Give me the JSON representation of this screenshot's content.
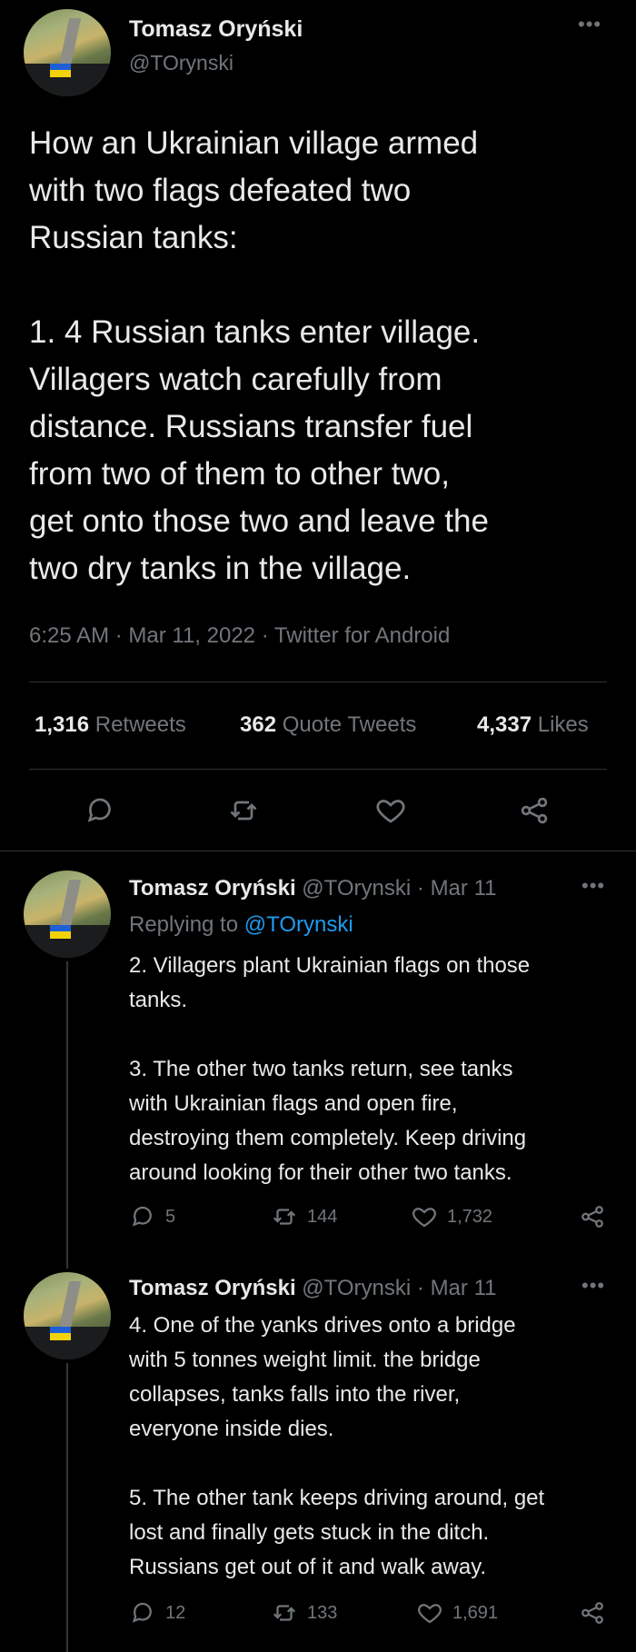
{
  "main_tweet": {
    "author_name": "Tomasz Oryński",
    "author_handle": "@TOrynski",
    "text_lines": [
      "How an Ukrainian village armed",
      "with two flags defeated two",
      "Russian tanks:",
      "",
      "1. 4 Russian tanks enter village.",
      "Villagers watch carefully from",
      "distance. Russians transfer fuel",
      "from two of them to other two,",
      "get onto those two and leave the",
      "two dry tanks in the village."
    ],
    "meta": "6:25 AM · Mar 11, 2022 · Twitter for Android",
    "stats": {
      "retweets_count": "1,316",
      "retweets_label": "Retweets",
      "quotes_count": "362",
      "quotes_label": "Quote Tweets",
      "likes_count": "4,337",
      "likes_label": "Likes"
    },
    "more_icon": "more-icon"
  },
  "replies": [
    {
      "author_name": "Tomasz Oryński",
      "author_handle": "@TOrynski",
      "date": "· Mar 11",
      "replying_prefix": "Replying to",
      "replying_handle": "@TOrynski",
      "text_lines": [
        "2. Villagers plant Ukrainian flags on those",
        "tanks.",
        "",
        "3. The other two tanks return, see tanks",
        "with Ukrainian flags and open fire,",
        "destroying them completely. Keep driving",
        "around looking for their other two tanks."
      ],
      "reply_count": "5",
      "retweet_count": "144",
      "like_count": "1,732"
    },
    {
      "author_name": "Tomasz Oryński",
      "author_handle": "@TOrynski",
      "date": "· Mar 11",
      "text_lines": [
        "4. One of the yanks drives onto a bridge",
        "with 5 tonnes weight limit. the bridge",
        "collapses, tanks falls into the river,",
        "everyone inside dies.",
        "",
        "5. The other tank keeps driving around, get",
        "lost and finally gets stuck in the ditch.",
        "Russians get out of it and walk away."
      ],
      "reply_count": "12",
      "retweet_count": "133",
      "like_count": "1,691"
    }
  ],
  "colors": {
    "background": "#000000",
    "text": "#e7e9ea",
    "muted": "#71767b",
    "link": "#1d9bf0",
    "divider": "#2f3336"
  }
}
